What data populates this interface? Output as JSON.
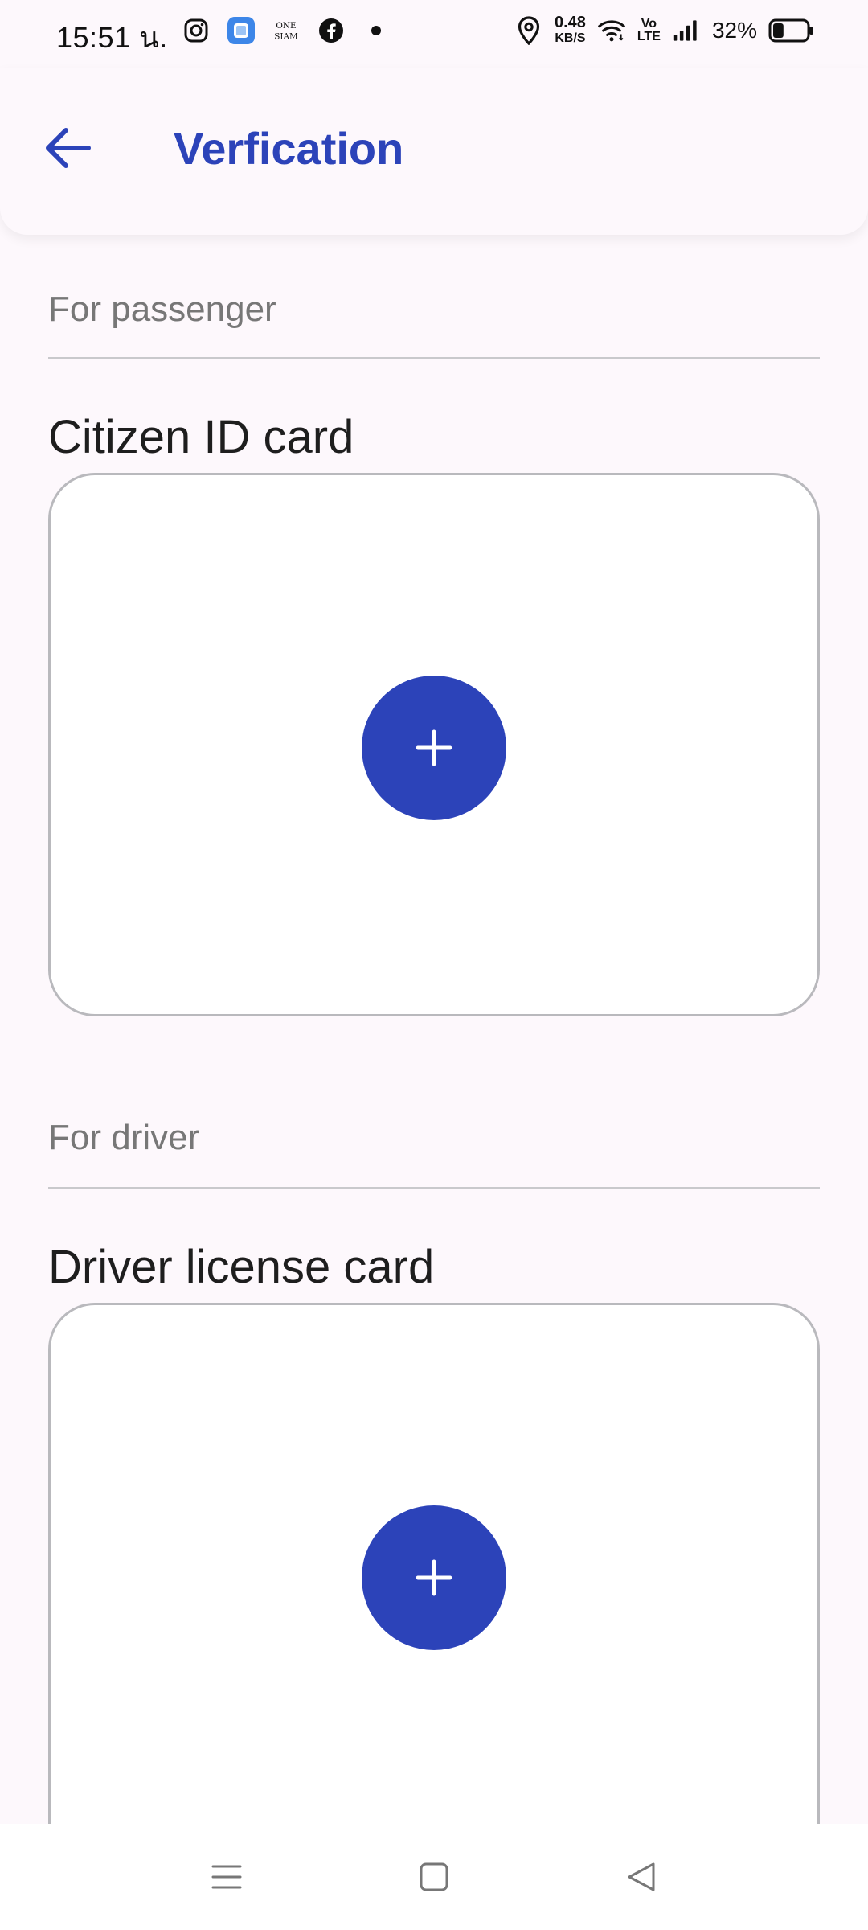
{
  "status_bar": {
    "time": "15:51 น.",
    "speed_value": "0.48",
    "speed_unit": "KB/S",
    "volte_top": "Vo",
    "volte_bottom": "LTE",
    "battery_percent": "32%",
    "battery_level": 0.32,
    "icons_left": [
      "instagram-icon",
      "app-icon",
      "onesiam-icon",
      "facebook-icon",
      "dot-icon"
    ],
    "icons_right": [
      "location-icon",
      "wifi-icon",
      "volte-icon",
      "signal-icon",
      "battery-icon"
    ]
  },
  "app_bar": {
    "title": "Verfication",
    "back_icon": "arrow-left-icon"
  },
  "passenger": {
    "section_label": "For passenger",
    "card_title": "Citizen ID card"
  },
  "driver": {
    "section_label": "For driver",
    "card_title": "Driver license card"
  },
  "nav_bar": {
    "icons": [
      "menu-icon",
      "home-icon",
      "back-triangle-icon"
    ]
  },
  "colors": {
    "accent": "#2c43b9",
    "background": "#fdf8fc",
    "muted_text": "#777777",
    "border": "#b9b9bd"
  }
}
